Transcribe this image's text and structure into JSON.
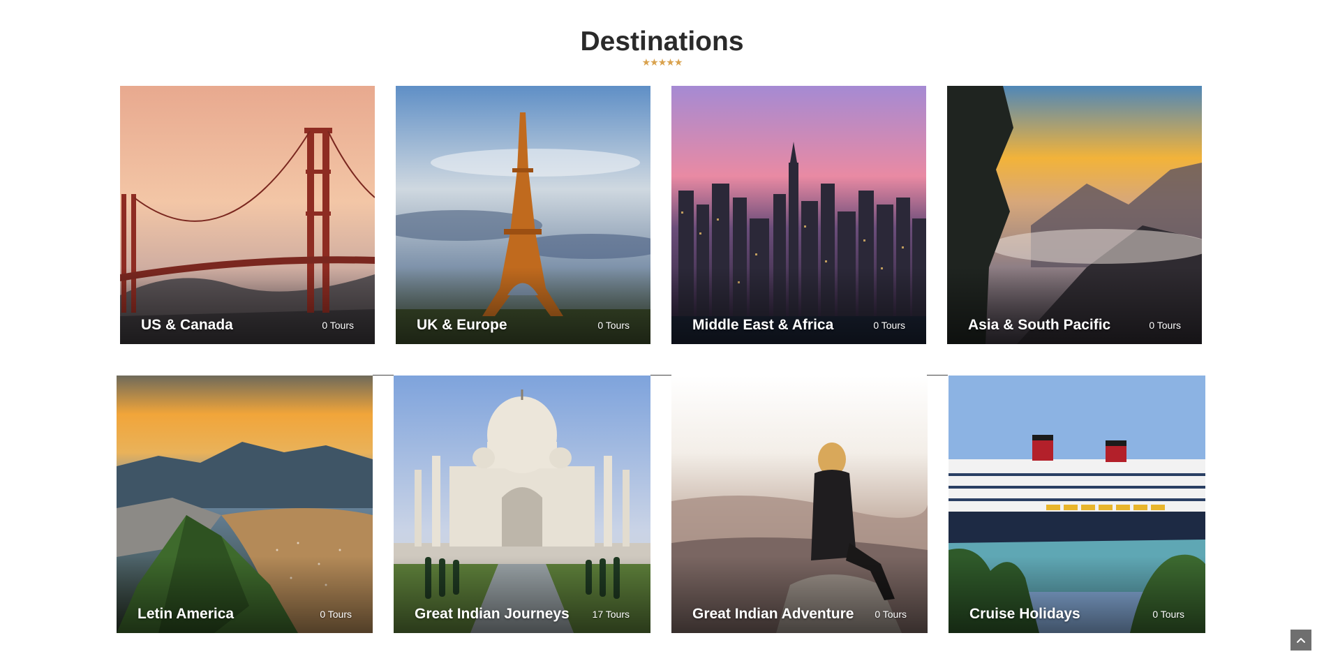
{
  "section": {
    "title": "Destinations",
    "rating": "★★★★★",
    "rating_color": "#d9a24e"
  },
  "destinations": [
    {
      "name": "US & Canada",
      "count": "0 Tours",
      "image": "golden-gate-bridge-sunset"
    },
    {
      "name": "UK & Europe",
      "count": "0 Tours",
      "image": "eiffel-tower-sky"
    },
    {
      "name": "Middle East & Africa",
      "count": "0 Tours",
      "image": "dubai-skyline-dusk"
    },
    {
      "name": "Asia & South Pacific",
      "count": "0 Tours",
      "image": "misty-mountains-sunrise"
    },
    {
      "name": "Letin America",
      "count": "0 Tours",
      "image": "rio-de-janeiro-bay"
    },
    {
      "name": "Great Indian Journeys",
      "count": "17 Tours",
      "image": "taj-mahal"
    },
    {
      "name": "Great Indian Adventure",
      "count": "0 Tours",
      "image": "woman-on-rock-mountains"
    },
    {
      "name": "Cruise Holidays",
      "count": "0 Tours",
      "image": "cruise-ship-harbor"
    }
  ],
  "scroll_top": {
    "icon": "chevron-up-icon"
  }
}
